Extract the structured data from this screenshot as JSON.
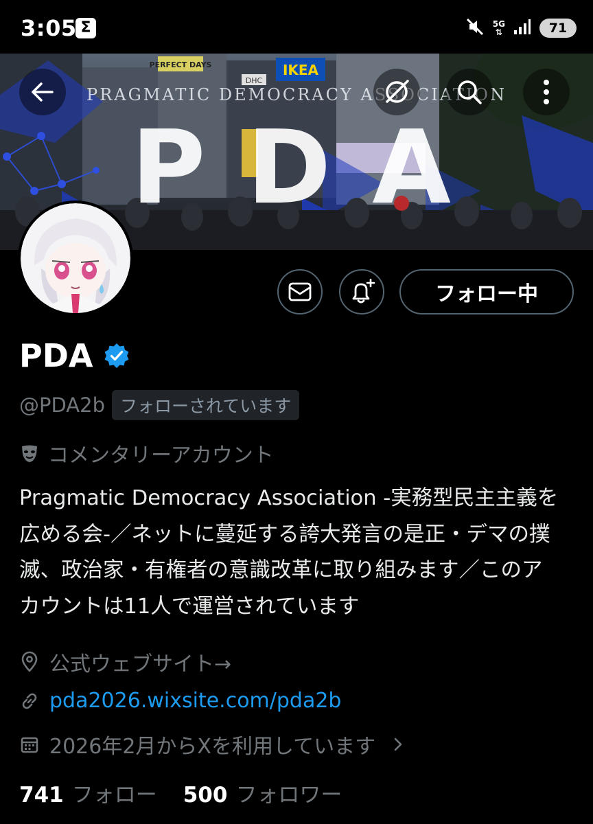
{
  "status_bar": {
    "time": "3:05",
    "notification_icon": "Σ",
    "network": "5G",
    "battery": "71"
  },
  "banner": {
    "subtitle": "PRAGMATIC DEMOCRACY ASSOCIATION",
    "title": "PDA",
    "sign_text_1": "PERFECT DAYS",
    "sign_text_2": "IKEA",
    "sign_text_3": "DHC",
    "accent_color": "#1f3bbf"
  },
  "profile": {
    "display_name": "PDA",
    "verified": true,
    "handle": "@PDA2b",
    "follows_you": "フォローされています",
    "category": "コメンタリーアカウント",
    "bio": "Pragmatic Democracy Association -実務型民主主義を\n広める会-／ネットに蔓延する誇大発言の是正・デマの撲\n滅、政治家・有権者の意識改革に取り組みます／このア\nカウントは11人で運営されています",
    "location": "公式ウェブサイト→",
    "website": "pda2026.wixsite.com/pda2b",
    "joined": "2026年2月からXを利用しています"
  },
  "actions": {
    "follow_label": "フォロー中"
  },
  "stats": {
    "following_count": "741",
    "following_label": "フォロー",
    "followers_count": "500",
    "followers_label": "フォロワー"
  },
  "colors": {
    "background": "#000000",
    "link": "#1d9bf0",
    "verified_badge": "#1d9bf0",
    "muted_text": "#71767b"
  }
}
